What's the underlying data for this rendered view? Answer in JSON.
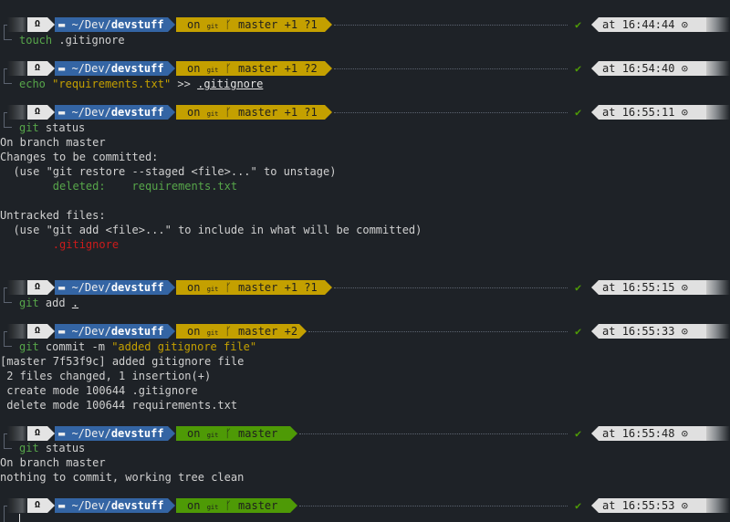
{
  "prompt": {
    "os_icon": "Ω",
    "dir_icon": "folder-icon",
    "dir_prefix": "~/Dev/",
    "dir_name": "devstuff",
    "git_on": "on",
    "git_icon": "git",
    "branch_icon": "branch-icon",
    "branch": "master",
    "status_ok": "✔",
    "time_prefix": "at",
    "clock_icon": "clock-icon"
  },
  "colors": {
    "background": "#1e2227",
    "dir_segment": "#3465a4",
    "git_dirty": "#c4a000",
    "git_clean": "#4e9a06",
    "error": "#cc1b1b"
  },
  "blocks": [
    {
      "git_status": "+1 ?1",
      "time": "16:44:44",
      "cmd": "touch",
      "args": ".gitignore",
      "output": []
    },
    {
      "git_status": "+1 ?2",
      "time": "16:54:40",
      "cmd": "echo",
      "args": "\"requirements.txt\"",
      "redirect": ">>",
      "target": ".gitignore",
      "output": []
    },
    {
      "git_status": "+1 ?1",
      "time": "16:55:11",
      "cmd": "git",
      "args": "status",
      "output": [
        "On branch master",
        "Changes to be committed:",
        "  (use \"git restore --staged <file>...\" to unstage)",
        "        deleted:    requirements.txt",
        "",
        "Untracked files:",
        "  (use \"git add <file>...\" to include in what will be committed)",
        "        .gitignore"
      ]
    },
    {
      "git_status": "+1 ?1",
      "time": "16:55:15",
      "cmd": "git",
      "args": "add",
      "target": ".",
      "output": []
    },
    {
      "git_status": "+2",
      "time": "16:55:33",
      "cmd": "git",
      "args": "commit -m",
      "message": "\"added gitignore file\"",
      "output": [
        "[master 7f53f9c] added gitignore file",
        " 2 files changed, 1 insertion(+)",
        " create mode 100644 .gitignore",
        " delete mode 100644 requirements.txt"
      ]
    },
    {
      "git_status": "",
      "time": "16:55:48",
      "cmd": "git",
      "args": "status",
      "output": [
        "On branch master",
        "nothing to commit, working tree clean"
      ]
    },
    {
      "git_status": "",
      "time": "16:55:53",
      "output": []
    }
  ]
}
